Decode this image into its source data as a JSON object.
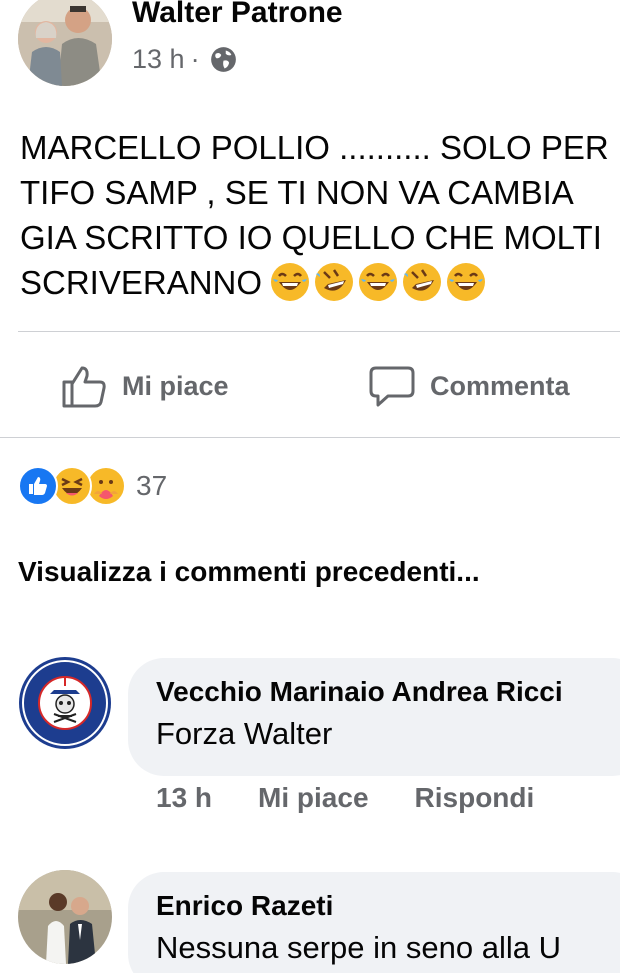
{
  "post": {
    "author": "Walter Patrone",
    "time": "13 h",
    "separator": "·",
    "text_lines": [
      "MARCELLO POLLIO .......... SOLO PER",
      "TIFO SAMP , SE TI NON VA CAMBIA",
      "GIA SCRITTO IO QUELLO CHE MOLTI",
      "SCRIVERANNO"
    ],
    "emojis": [
      "joy-emoji",
      "rofl-emoji",
      "joy-emoji",
      "rofl-emoji",
      "joy-emoji"
    ]
  },
  "actions": {
    "like": "Mi piace",
    "comment": "Commenta"
  },
  "reactions": {
    "icons": [
      "like-reaction-icon",
      "haha-reaction-icon",
      "care-reaction-icon"
    ],
    "count": "37"
  },
  "view_previous": "Visualizza i commenti precedenti...",
  "comments": [
    {
      "name": "Vecchio Marinaio Andrea Ricci",
      "text": "Forza Walter",
      "time": "13 h",
      "like": "Mi piace",
      "reply": "Rispondi",
      "avatar_text_top": "VECCHIO MARINAIO",
      "avatar_text_bottom": "U.C. SAMPDORIA 1946"
    },
    {
      "name": "Enrico Razeti",
      "text": "Nessuna serpe in seno alla U"
    }
  ],
  "colors": {
    "text": "#050505",
    "secondary": "#65676b",
    "bubble": "#f0f2f5",
    "divider": "#ced0d4",
    "like_blue": "#1877f2",
    "haha_yellow": "#f7b928"
  }
}
